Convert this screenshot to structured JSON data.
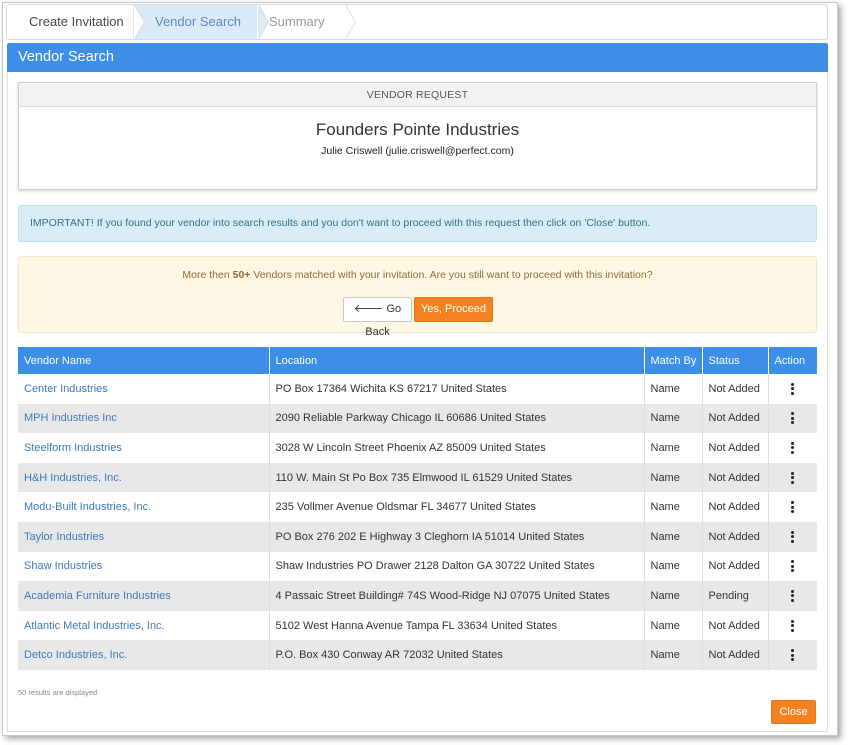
{
  "wizard": {
    "steps": [
      {
        "label": "Create Invitation"
      },
      {
        "label": "Vendor Search"
      },
      {
        "label": "Summary"
      }
    ]
  },
  "panel": {
    "title": "Vendor Search"
  },
  "request": {
    "header": "VENDOR REQUEST",
    "company": "Founders Pointe Industries",
    "contact": "Julie Criswell (julie.criswell@perfect.com)"
  },
  "info": {
    "text": "IMPORTANT! If you found your vendor into search results and you don't want to proceed with this request then click on 'Close' button."
  },
  "warning": {
    "prefix": "More then ",
    "count": "50+",
    "suffix": " Vendors matched with your invitation. Are you still want to proceed with this invitation?",
    "go_back_label": "Go Back",
    "proceed_label": "Yes, Proceed"
  },
  "table": {
    "columns": [
      "Vendor Name",
      "Location",
      "Match By",
      "Status",
      "Action"
    ],
    "rows": [
      {
        "name": "Center Industries",
        "location": "PO Box 17364 Wichita KS 67217 United States",
        "match": "Name",
        "status": "Not Added"
      },
      {
        "name": "MPH Industries Inc",
        "location": "2090 Reliable Parkway Chicago IL 60686 United States",
        "match": "Name",
        "status": "Not Added"
      },
      {
        "name": "Steelform Industries",
        "location": "3028 W Lincoln Street Phoenix AZ 85009 United States",
        "match": "Name",
        "status": "Not Added"
      },
      {
        "name": "H&H Industries, Inc.",
        "location": "110 W. Main St Po Box 735 Elmwood IL 61529 United States",
        "match": "Name",
        "status": "Not Added"
      },
      {
        "name": "Modu-Built Industries, Inc.",
        "location": "235 Vollmer Avenue Oldsmar FL 34677 United States",
        "match": "Name",
        "status": "Not Added"
      },
      {
        "name": "Taylor Industries",
        "location": "PO Box 276 202 E Highway 3 Cleghorn IA 51014 United States",
        "match": "Name",
        "status": "Not Added"
      },
      {
        "name": "Shaw Industries",
        "location": "Shaw Industries PO Drawer 2128 Dalton GA 30722 United States",
        "match": "Name",
        "status": "Not Added"
      },
      {
        "name": "Academia Furniture Industries",
        "location": "4 Passaic Street Building# 74S Wood-Ridge NJ 07075 United States",
        "match": "Name",
        "status": "Pending"
      },
      {
        "name": "Atlantic Metal Industries, Inc.",
        "location": "5102 West Hanna Avenue Tampa FL 33634 United States",
        "match": "Name",
        "status": "Not Added"
      },
      {
        "name": "Detco Industries, Inc.",
        "location": "P.O. Box 430 Conway AR 72032 United States",
        "match": "Name",
        "status": "Not Added"
      }
    ]
  },
  "footer": {
    "results_text": "50 results are displayed",
    "close_label": "Close"
  },
  "icons": {
    "go_back": "arrow-left-icon",
    "row_action": "kebab-menu-icon"
  },
  "colors": {
    "primary": "#3d8ee6",
    "accent": "#f58220",
    "link": "#3d7ab8",
    "info_bg": "#d9edf7",
    "warning_bg": "#fcf8e3"
  }
}
